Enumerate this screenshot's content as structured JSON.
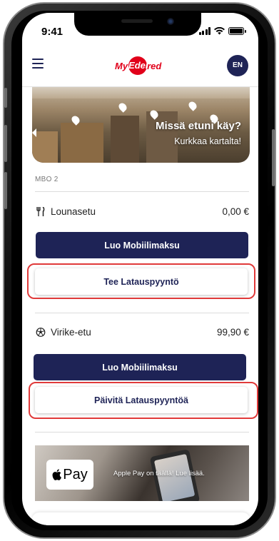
{
  "status_bar": {
    "time": "9:41"
  },
  "header": {
    "logo_part1": "My",
    "logo_part2": "Eden",
    "logo_part3": "red",
    "language": "EN"
  },
  "map_banner": {
    "title": "Missä etuni käy?",
    "subtitle": "Kurkkaa kartalta!"
  },
  "section": {
    "label": "MBO 2"
  },
  "benefits": [
    {
      "icon": "fork-knife-icon",
      "name": "Lounasetu",
      "amount": "0,00 €",
      "primary_action": "Luo Mobiilimaksu",
      "secondary_action": "Tee Latauspyyntö"
    },
    {
      "icon": "soccer-ball-icon",
      "name": "Virike-etu",
      "amount": "99,90 €",
      "primary_action": "Luo Mobiilimaksu",
      "secondary_action": "Päivitä Latauspyyntöä"
    }
  ],
  "apple_pay_banner": {
    "badge": "Pay",
    "text": "Apple Pay on täällä! Lue lisää."
  },
  "colors": {
    "navy": "#1e2356",
    "brand_red": "#e1001a",
    "highlight_red": "#e03a3a"
  }
}
